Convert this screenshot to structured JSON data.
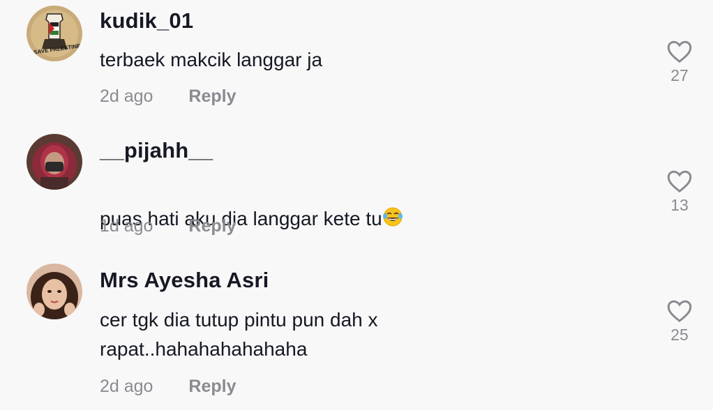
{
  "comments": [
    {
      "username": "kudik_01",
      "text": "terbaek makcik langgar ja",
      "time": "2d ago",
      "reply_label": "Reply",
      "likes": "27",
      "avatar_text": "SAVE PALESTINE"
    },
    {
      "username": "__pijahh__",
      "text": "puas hati aku dia langgar kete tu",
      "emoji": "face-with-tears-of-joy",
      "time": "1d ago",
      "reply_label": "Reply",
      "likes": "13"
    },
    {
      "username": "Mrs Ayesha Asri",
      "text": "cer tgk dia tutup pintu pun dah x\nrapat..hahahahahahaha",
      "time": "2d ago",
      "reply_label": "Reply",
      "likes": "25"
    }
  ],
  "colors": {
    "background": "#f8f8f8",
    "username": "#161823",
    "secondary": "#8a8b91"
  }
}
